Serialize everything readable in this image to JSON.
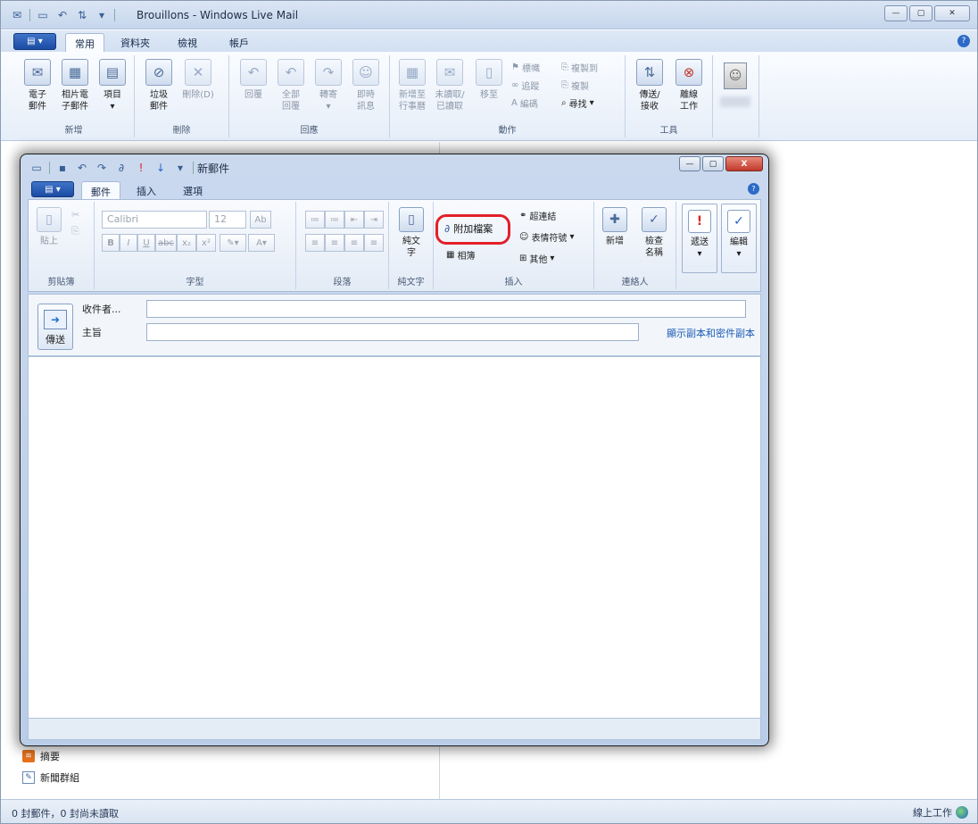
{
  "window": {
    "title": "Brouillons - Windows Live Mail",
    "tabs": [
      "常用",
      "資料夾",
      "檢視",
      "帳戶"
    ]
  },
  "ribbon": {
    "new_group": {
      "label": "新增",
      "email": "電子\n郵件",
      "photo_email": "相片電\n子郵件",
      "items": "項目"
    },
    "delete_group": {
      "label": "刪除",
      "junk": "垃圾\n郵件",
      "delete": "刪除(D)"
    },
    "respond_group": {
      "label": "回應",
      "reply": "回覆",
      "reply_all": "全部\n回覆",
      "forward": "轉寄",
      "instant_msg": "即時\n訊息"
    },
    "actions_group": {
      "label": "動作",
      "add_calendar": "新增至\n行事曆",
      "unread_read": "未讀取/\n已讀取",
      "move_to": "移至",
      "flag": "標幟",
      "watch": "追蹤",
      "encoding": "編碼",
      "copy_to": "複製到",
      "copy": "複製",
      "find": "尋找"
    },
    "tools_group": {
      "label": "工具",
      "send_receive": "傳送/\n接收",
      "work_offline": "離線\n工作"
    }
  },
  "left_pane": {
    "feeds": "摘要",
    "newsgroups": "新聞群組"
  },
  "status": {
    "left": "0 封郵件，0 封尚未讀取",
    "right": "線上工作"
  },
  "compose": {
    "title": "新郵件",
    "tabs": [
      "郵件",
      "插入",
      "選項"
    ],
    "clipboard": {
      "label": "剪貼簿",
      "paste": "貼上"
    },
    "font": {
      "label": "字型",
      "family": "Calibri",
      "size": "12"
    },
    "paragraph": {
      "label": "段落"
    },
    "plaintext": {
      "label": "純文字",
      "button": "純文\n字"
    },
    "insert": {
      "label": "插入",
      "attach": "附加檔案",
      "hyperlink": "超連結",
      "emoticon": "表情符號",
      "album": "相簿",
      "other": "其他"
    },
    "contacts": {
      "label": "連絡人",
      "new": "新增",
      "check_names": "檢查\n名稱"
    },
    "send_btn_small": "遞送",
    "edit_btn": "編輯",
    "send": "傳送",
    "to_label": "收件者...",
    "subject_label": "主旨",
    "cc_link": "顯示副本和密件副本"
  }
}
